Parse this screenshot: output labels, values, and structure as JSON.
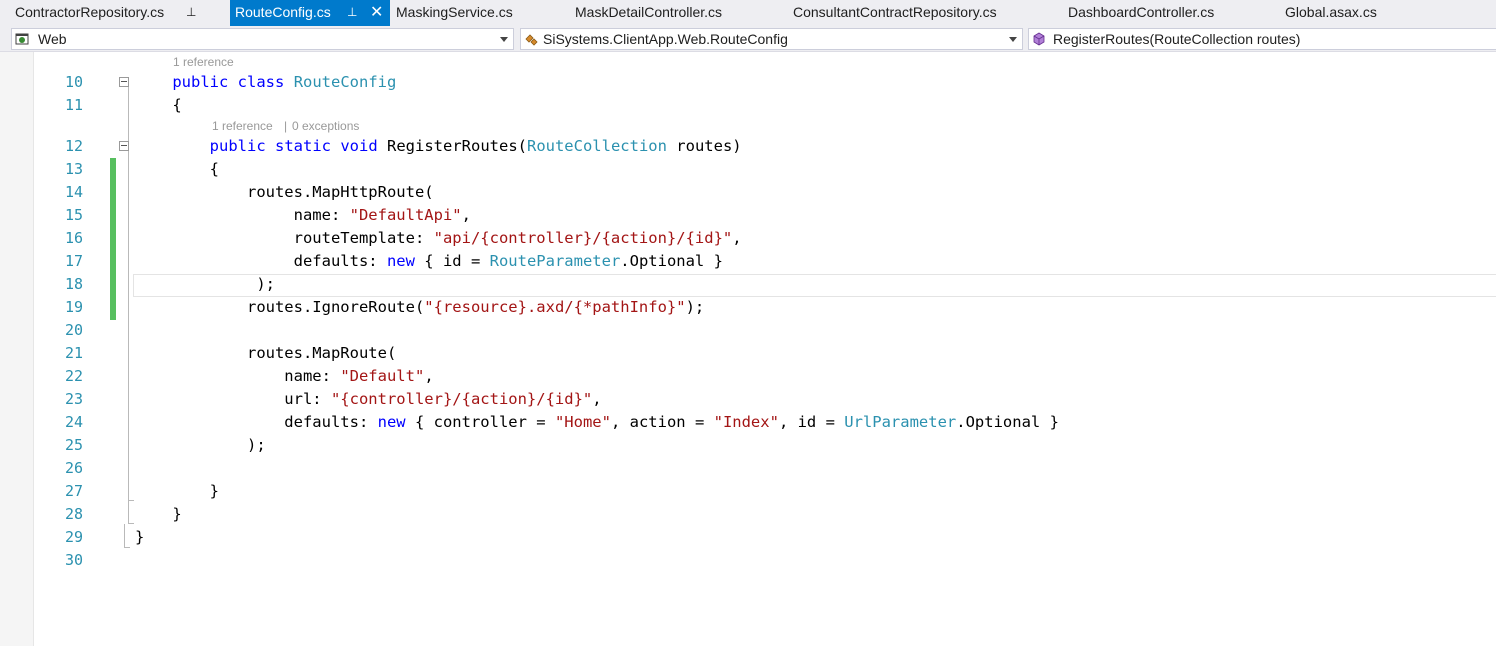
{
  "tabs": [
    {
      "label": "ContractorRepository.cs",
      "pinned": true
    },
    {
      "label": "RouteConfig.cs",
      "active": true,
      "pinned": true,
      "closable": true
    },
    {
      "label": "MaskingService.cs"
    },
    {
      "label": "MaskDetailController.cs"
    },
    {
      "label": "ConsultantContractRepository.cs"
    },
    {
      "label": "DashboardController.cs"
    },
    {
      "label": "Global.asax.cs"
    }
  ],
  "tab_glyphs": {
    "pin": "⊥",
    "close": "✕"
  },
  "navbar": {
    "project": "Web",
    "type": "SiSystems.ClientApp.Web.RouteConfig",
    "member": "RegisterRoutes(RouteCollection routes)"
  },
  "codelens": {
    "class_refs": "1 reference",
    "method_refs": "1 reference",
    "method_sep": "|",
    "method_exceptions": "0 exceptions"
  },
  "lines": [
    {
      "n": "10",
      "tokens": [
        [
          "    ",
          ""
        ],
        [
          "public",
          "kw"
        ],
        [
          " ",
          ""
        ],
        [
          "class",
          "kw"
        ],
        [
          " ",
          ""
        ],
        [
          "RouteConfig",
          "ty"
        ]
      ]
    },
    {
      "n": "11",
      "tokens": [
        [
          "    {",
          ""
        ]
      ]
    },
    {
      "n": "12",
      "tokens": [
        [
          "        ",
          ""
        ],
        [
          "public",
          "kw"
        ],
        [
          " ",
          ""
        ],
        [
          "static",
          "kw"
        ],
        [
          " ",
          ""
        ],
        [
          "void",
          "kw"
        ],
        [
          " RegisterRoutes(",
          ""
        ],
        [
          "RouteCollection",
          "ty"
        ],
        [
          " routes)",
          ""
        ]
      ]
    },
    {
      "n": "13",
      "tokens": [
        [
          "        {",
          ""
        ]
      ]
    },
    {
      "n": "14",
      "tokens": [
        [
          "            routes.MapHttpRoute(",
          ""
        ]
      ]
    },
    {
      "n": "15",
      "tokens": [
        [
          "                 name: ",
          ""
        ],
        [
          "\"DefaultApi\"",
          "st"
        ],
        [
          ",",
          ""
        ]
      ]
    },
    {
      "n": "16",
      "tokens": [
        [
          "                 routeTemplate: ",
          ""
        ],
        [
          "\"api/{controller}/{action}/{id}\"",
          "st"
        ],
        [
          ",",
          ""
        ]
      ]
    },
    {
      "n": "17",
      "tokens": [
        [
          "                 defaults: ",
          ""
        ],
        [
          "new",
          "kw"
        ],
        [
          " { id = ",
          ""
        ],
        [
          "RouteParameter",
          "ty"
        ],
        [
          ".Optional }",
          ""
        ]
      ]
    },
    {
      "n": "18",
      "tokens": [
        [
          "             );",
          ""
        ]
      ]
    },
    {
      "n": "19",
      "tokens": [
        [
          "            routes.IgnoreRoute(",
          ""
        ],
        [
          "\"{resource}.axd/{*pathInfo}\"",
          "st"
        ],
        [
          ");",
          ""
        ]
      ]
    },
    {
      "n": "20",
      "tokens": [
        [
          "",
          ""
        ]
      ]
    },
    {
      "n": "21",
      "tokens": [
        [
          "            routes.MapRoute(",
          ""
        ]
      ]
    },
    {
      "n": "22",
      "tokens": [
        [
          "                name: ",
          ""
        ],
        [
          "\"Default\"",
          "st"
        ],
        [
          ",",
          ""
        ]
      ]
    },
    {
      "n": "23",
      "tokens": [
        [
          "                url: ",
          ""
        ],
        [
          "\"{controller}/{action}/{id}\"",
          "st"
        ],
        [
          ",",
          ""
        ]
      ]
    },
    {
      "n": "24",
      "tokens": [
        [
          "                defaults: ",
          ""
        ],
        [
          "new",
          "kw"
        ],
        [
          " { controller = ",
          ""
        ],
        [
          "\"Home\"",
          "st"
        ],
        [
          ", action = ",
          ""
        ],
        [
          "\"Index\"",
          "st"
        ],
        [
          ", id = ",
          ""
        ],
        [
          "UrlParameter",
          "ty"
        ],
        [
          ".Optional }",
          ""
        ]
      ]
    },
    {
      "n": "25",
      "tokens": [
        [
          "            );",
          ""
        ]
      ]
    },
    {
      "n": "26",
      "tokens": [
        [
          "",
          ""
        ]
      ]
    },
    {
      "n": "27",
      "tokens": [
        [
          "        }",
          ""
        ]
      ]
    },
    {
      "n": "28",
      "tokens": [
        [
          "    }",
          ""
        ]
      ]
    },
    {
      "n": "29",
      "tokens": [
        [
          "}",
          ""
        ]
      ]
    },
    {
      "n": "30",
      "tokens": [
        [
          "",
          ""
        ]
      ]
    }
  ],
  "colors": {
    "keyword": "#0000ff",
    "type": "#2b91af",
    "string": "#a31515",
    "active_tab": "#007acc",
    "change_bar": "#57bf5f"
  }
}
